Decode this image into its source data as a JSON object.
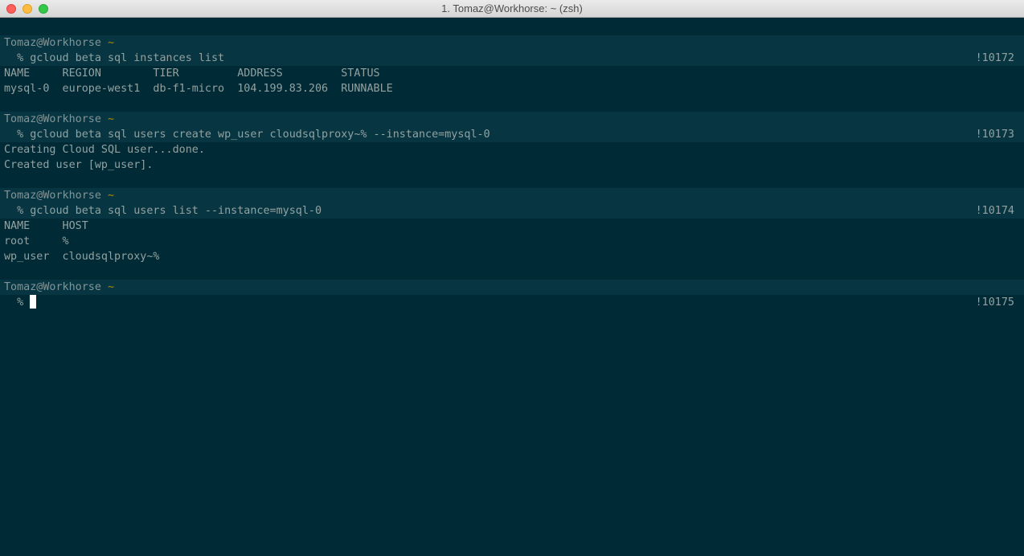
{
  "window": {
    "title": "1. Tomaz@Workhorse: ~ (zsh)"
  },
  "blocks": [
    {
      "prompt_user": "Tomaz@Workhorse",
      "prompt_dir": "~",
      "command": "  % gcloud beta sql instances list",
      "history": "!10172",
      "output": [
        "NAME     REGION        TIER         ADDRESS         STATUS",
        "mysql-0  europe-west1  db-f1-micro  104.199.83.206  RUNNABLE"
      ]
    },
    {
      "prompt_user": "Tomaz@Workhorse",
      "prompt_dir": "~",
      "command": "  % gcloud beta sql users create wp_user cloudsqlproxy~% --instance=mysql-0",
      "history": "!10173",
      "output": [
        "Creating Cloud SQL user...done.",
        "Created user [wp_user]."
      ]
    },
    {
      "prompt_user": "Tomaz@Workhorse",
      "prompt_dir": "~",
      "command": "  % gcloud beta sql users list --instance=mysql-0",
      "history": "!10174",
      "output": [
        "NAME     HOST",
        "root     %",
        "wp_user  cloudsqlproxy~%"
      ]
    },
    {
      "prompt_user": "Tomaz@Workhorse",
      "prompt_dir": "~",
      "command": "  % ",
      "history": "!10175",
      "output": []
    }
  ],
  "colors": {
    "background": "#002b36",
    "prompt_bar": "#073642",
    "text": "#93a1a1",
    "tilde": "#b58900"
  }
}
